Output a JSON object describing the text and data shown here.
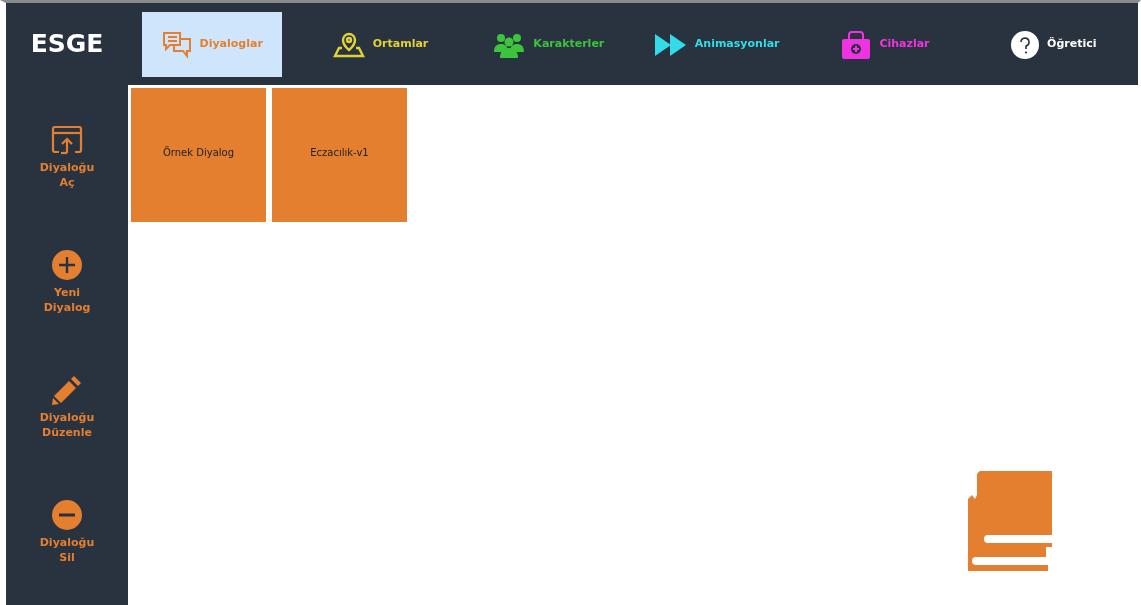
{
  "app": {
    "logo": "ESGE"
  },
  "tabs": [
    {
      "label": "Diyaloglar",
      "kind": "chat",
      "color": "#e57f30",
      "selected": true
    },
    {
      "label": "Ortamlar",
      "kind": "location",
      "color": "#e3d233",
      "selected": false
    },
    {
      "label": "Karakterler",
      "kind": "people",
      "color": "#3cc43c",
      "selected": false
    },
    {
      "label": "Animasyonlar",
      "kind": "forward",
      "color": "#33dbe8",
      "selected": false
    },
    {
      "label": "Cihazlar",
      "kind": "kit",
      "color": "#f033e0",
      "selected": false
    },
    {
      "label": "Öğretici",
      "kind": "help",
      "color": "#ffffff",
      "selected": false
    }
  ],
  "sidebar": {
    "items": [
      {
        "label": "Diyaloğu Aç",
        "kind": "open"
      },
      {
        "label": "Yeni Diyalog",
        "kind": "add"
      },
      {
        "label": "Diyaloğu Düzenle",
        "kind": "edit"
      },
      {
        "label": "Diyaloğu Sil",
        "kind": "remove"
      }
    ]
  },
  "dialogs": [
    {
      "title": "Örnek Diyalog"
    },
    {
      "title": "Eczacılık-v1"
    }
  ]
}
